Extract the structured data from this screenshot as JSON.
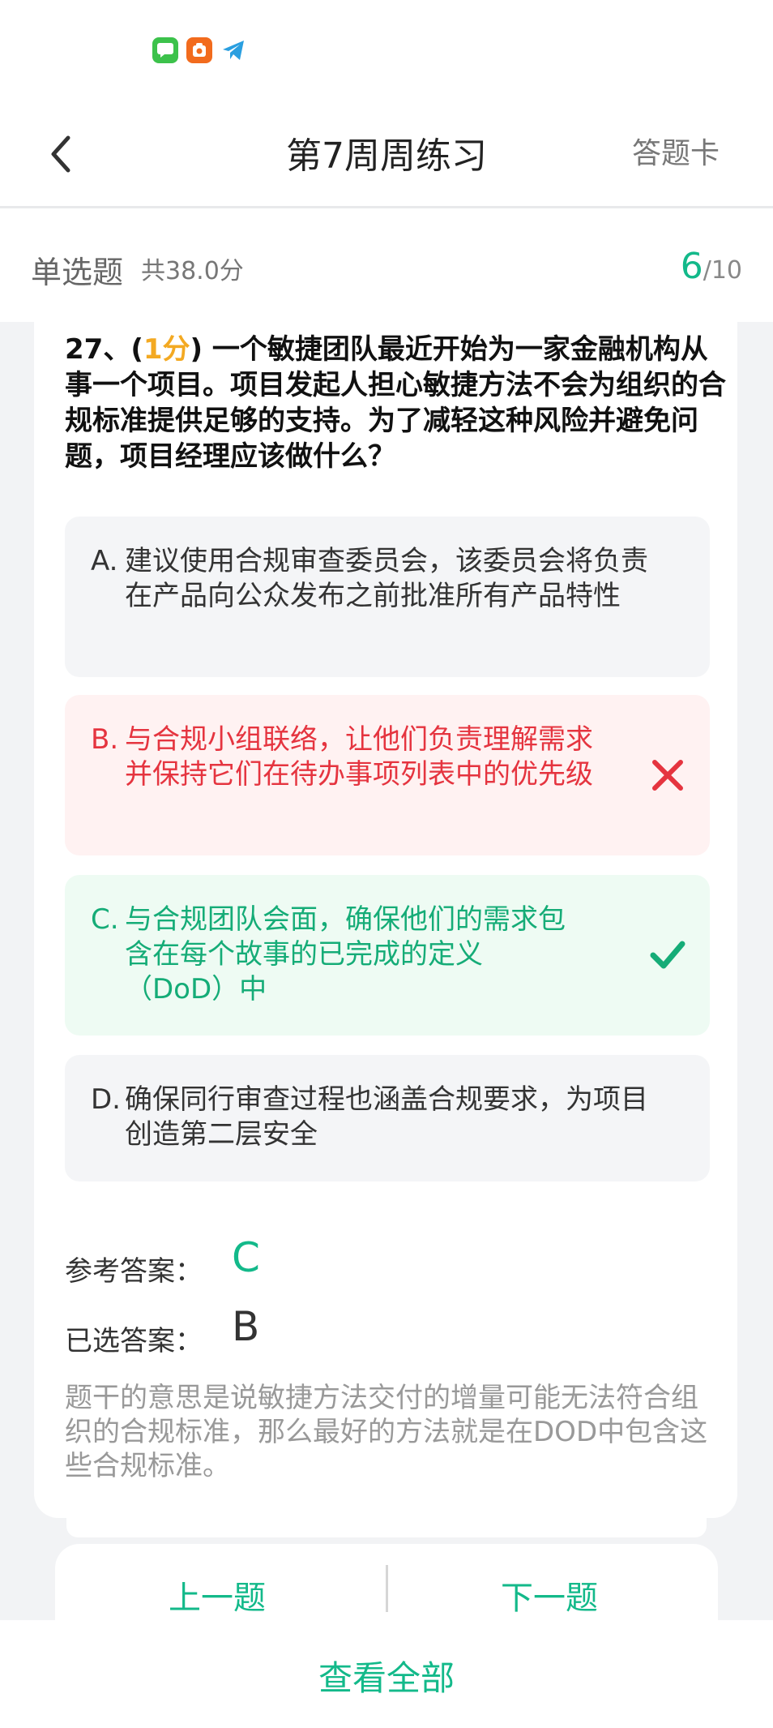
{
  "status_icons": [
    "messages-icon",
    "app-icon",
    "telegram-icon"
  ],
  "header": {
    "title": "第7周周练习",
    "right_label": "答题卡"
  },
  "section": {
    "type": "单选题",
    "score": "共38.0分",
    "progress_current": "6",
    "progress_total": "/10"
  },
  "question": {
    "number": "27、(",
    "points": "1分",
    "stem": ") 一个敏捷团队最近开始为一家金融机构从事一个项目。项目发起人担心敏捷方法不会为组织的合规标准提供足够的支持。为了减轻这种风险并避免问题，项目经理应该做什么？"
  },
  "options": [
    {
      "letter": "A.",
      "text": "建议使用合规审查委员会，该委员会将负责在产品向公众发布之前批准所有产品特性",
      "state": "normal"
    },
    {
      "letter": "B.",
      "text": "与合规小组联络，让他们负责理解需求并保持它们在待办事项列表中的优先级",
      "state": "wrong"
    },
    {
      "letter": "C.",
      "text": "与合规团队会面，确保他们的需求包含在每个故事的已完成的定义（DoD）中",
      "state": "correct"
    },
    {
      "letter": "D.",
      "text": "确保同行审查过程也涵盖合规要求，为项目创造第二层安全",
      "state": "normal"
    }
  ],
  "answers": {
    "reference_label": "参考答案：",
    "reference_value": "C",
    "selected_label": "已选答案：",
    "selected_value": "B"
  },
  "explanation": "题干的意思是说敏捷方法交付的增量可能无法符合组织的合规标准，那么最好的方法就是在DOD中包含这些合规标准。",
  "nav": {
    "prev": "上一题",
    "next": "下一题",
    "view_all": "查看全部"
  },
  "colors": {
    "accent": "#13b98a",
    "wrong": "#e5343f",
    "points": "#f3a922"
  }
}
